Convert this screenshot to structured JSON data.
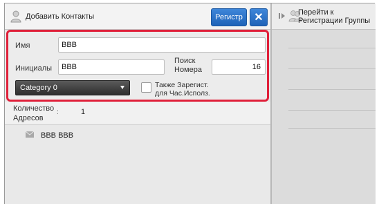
{
  "header": {
    "title": "Добавить Контакты",
    "register_label": "Регистр",
    "close_label": "✕"
  },
  "form": {
    "name_label": "Имя",
    "name_value": "BBB",
    "initials_label": "Инициалы",
    "initials_value": "BBB",
    "search_number_label_line1": "Поиск",
    "search_number_label_line2": "Номера",
    "search_number_value": "16",
    "category_value": "Category 0",
    "also_register_line1": "Также Зарегист.",
    "also_register_line2": "для Час.Исполз."
  },
  "address_count": {
    "label_line1": "Количество",
    "label_line2": "Адресов",
    "separator": ":",
    "value": "1"
  },
  "list": {
    "items": [
      {
        "label": "BBB BBB"
      }
    ]
  },
  "right_panel": {
    "link_line1": "Перейти к",
    "link_line2": "Регистрации Группы"
  },
  "colors": {
    "accent_blue": "#2a72c8",
    "highlight_red": "#e0203a"
  },
  "icons": {
    "header": "person-add-icon",
    "close": "close-icon",
    "dropdown": "chevron-down-icon",
    "list_item": "mail-icon",
    "expand": "play-icon",
    "group": "group-icon"
  }
}
